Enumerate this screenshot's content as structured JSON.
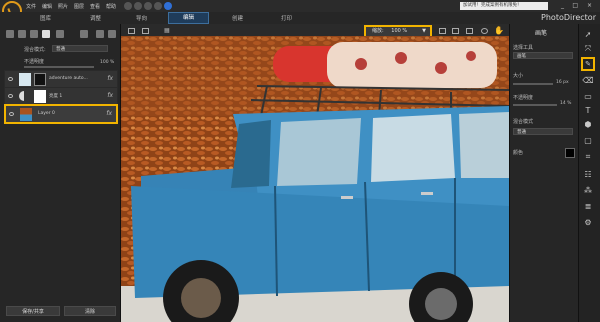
{
  "menu": [
    "文件",
    "编辑",
    "照片",
    "图层",
    "查看",
    "帮助"
  ],
  "update_notice": "加试用！完成案例有机限免！",
  "window_controls": [
    "_",
    "□",
    "×"
  ],
  "brand": "PhotoDirector",
  "mode_tabs": [
    {
      "label": "图库",
      "active": false
    },
    {
      "label": "调整",
      "active": false
    },
    {
      "label": "导向",
      "active": false
    },
    {
      "label": "编辑",
      "active": true
    },
    {
      "label": "创建",
      "active": false
    },
    {
      "label": "打印",
      "active": false
    }
  ],
  "left_panel": {
    "blend_mode_label": "混合模式:",
    "blend_mode_value": "普通",
    "opacity_label": "不透明度",
    "opacity_value": "100 %",
    "layers": [
      {
        "name": "adventure auto...",
        "fx": "fx"
      },
      {
        "name": "亮度 1",
        "fx": "fx"
      },
      {
        "name": "Layer 0",
        "fx": "fx",
        "selected": true
      }
    ],
    "save_button": "保存/共享",
    "clear_button": "清除"
  },
  "toolbar": {
    "zoom_label": "缩放:",
    "zoom_value": "100 %"
  },
  "right_panel": {
    "title": "画笔",
    "brush_tool_label": "选择工具",
    "brush_tool_value": "画笔",
    "size_label": "大小",
    "size_value": "16 px",
    "opacity_label": "不透明度",
    "opacity_value": "14 %",
    "blend_label": "混合模式",
    "blend_value": "普通",
    "color_label": "颜色"
  },
  "tools": [
    "pointer-icon",
    "move-icon",
    "brush-icon",
    "eraser-icon",
    "rect-icon",
    "text-icon",
    "fill-icon",
    "shape-icon",
    "crop-icon",
    "adjust-icon",
    "effects-icon",
    "layers-icon",
    "settings-icon"
  ],
  "colors": {
    "highlight": "#f2b400",
    "car_blue": "#3f90c4",
    "leaves": "#a8531f",
    "accent": "#e09a1a"
  }
}
